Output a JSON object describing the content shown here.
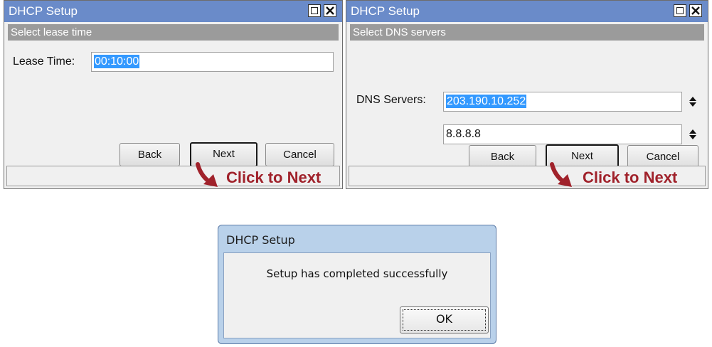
{
  "window_lease": {
    "title": "DHCP Setup",
    "section": "Select lease time",
    "lease_label": "Lease Time:",
    "lease_value": "00:10:00",
    "back": "Back",
    "next": "Next",
    "cancel": "Cancel",
    "annotation": "Click to Next"
  },
  "window_dns": {
    "title": "DHCP Setup",
    "section": "Select DNS servers",
    "dns_label": "DNS Servers:",
    "dns_primary": "203.190.10.252",
    "dns_secondary": "8.8.8.8",
    "back": "Back",
    "next": "Next",
    "cancel": "Cancel",
    "annotation": "Click to Next"
  },
  "dialog": {
    "title": "DHCP Setup",
    "message": "Setup has completed successfully",
    "ok": "OK"
  },
  "icons": [
    "maximize-icon",
    "close-icon",
    "spinner-icon",
    "arrow-icon"
  ],
  "colors": {
    "titlebar": "#6a8bc9",
    "section_bar": "#9b9b9b",
    "annotation": "#a0222b",
    "selection": "#3399ff",
    "dialog_frame": "#b9d1ea"
  }
}
